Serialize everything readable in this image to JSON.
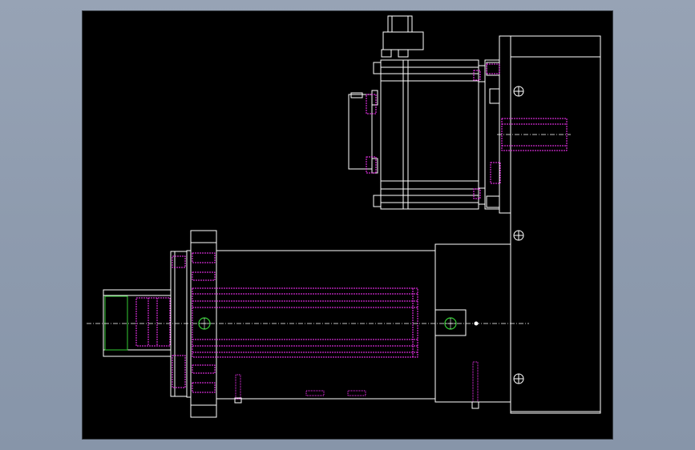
{
  "viewport": {
    "background": "#000000",
    "page_background": "#929fb2"
  },
  "colors": {
    "outline": "#ffffff",
    "hidden_line": "#ff33ff",
    "center_mark": "#33cc33",
    "center_line": "#ffffff"
  },
  "icons": {
    "center_mark_icon": "circle-with-cross",
    "bolt_icon": "threaded-bolt"
  },
  "labels": {}
}
